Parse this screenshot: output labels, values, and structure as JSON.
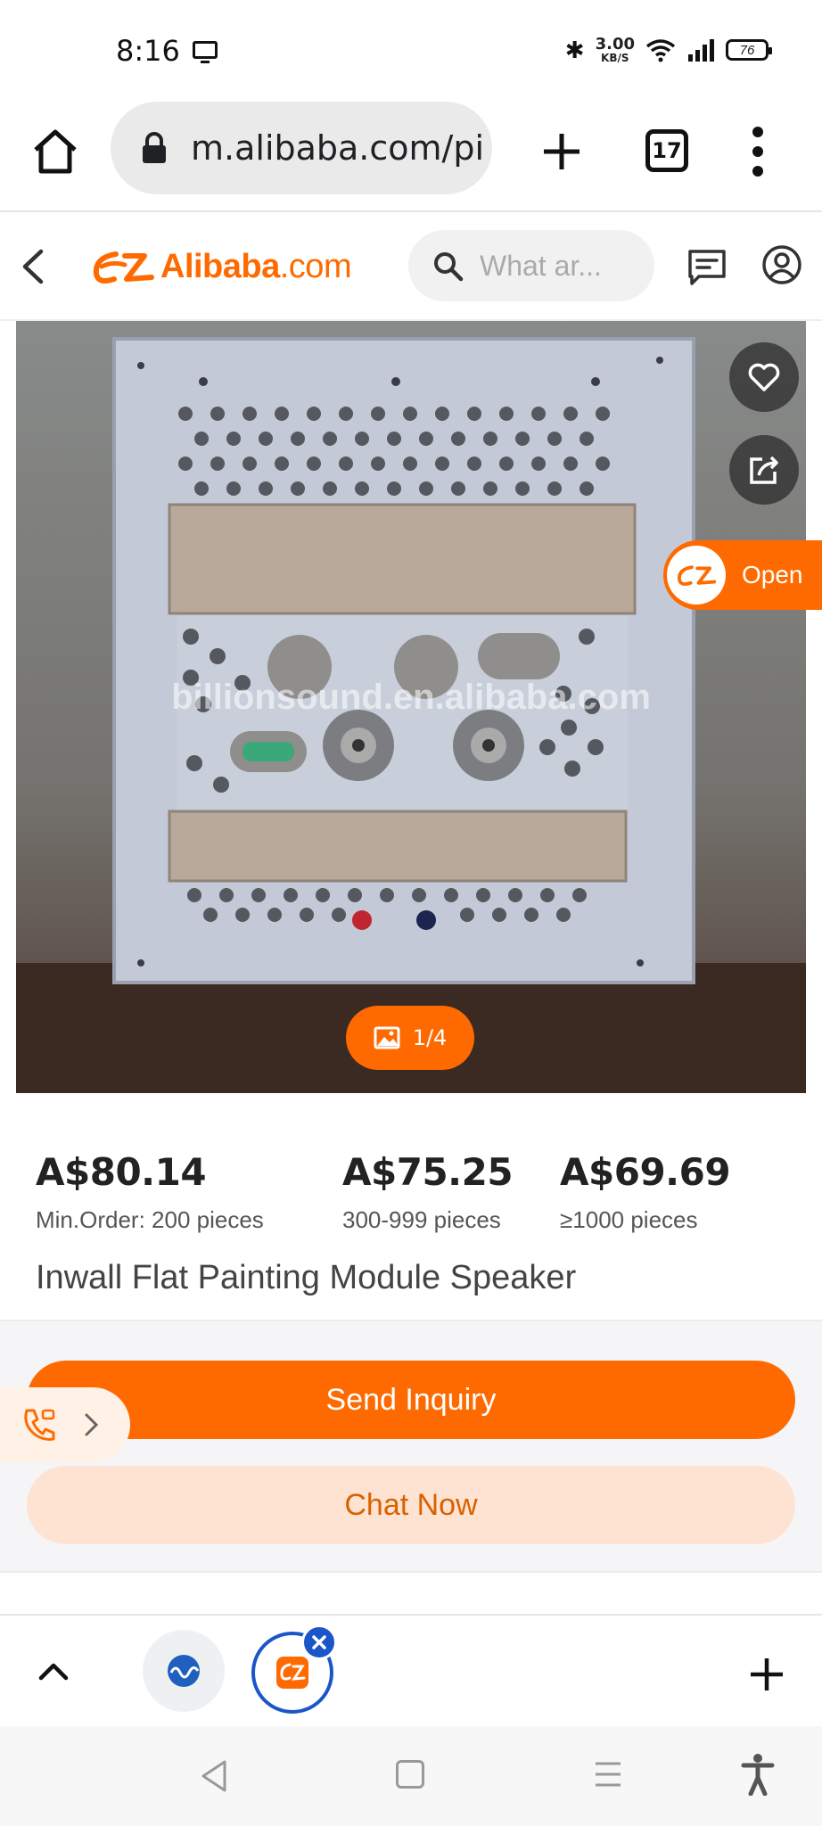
{
  "status_bar": {
    "time": "8:16",
    "net_speed_value": "3.00",
    "net_speed_unit": "KB/S",
    "battery": "76"
  },
  "browser": {
    "url": "m.alibaba.com/pi",
    "tab_count": "17"
  },
  "header": {
    "logo_text": "Alibaba",
    "logo_suffix": ".com",
    "search_placeholder": "What ar..."
  },
  "product_image": {
    "watermark": "billionsound.en.alibaba.com",
    "counter": "1/4",
    "open_label": "Open"
  },
  "prices": [
    {
      "price": "A$80.14",
      "qty": "Min.Order: 200 pieces"
    },
    {
      "price": "A$75.25",
      "qty": "300-999 pieces"
    },
    {
      "price": "A$69.69",
      "qty": "≥1000 pieces"
    }
  ],
  "product_title": "Inwall Flat Painting Module Speaker",
  "actions": {
    "send_inquiry": "Send Inquiry",
    "chat_now": "Chat Now"
  },
  "colors": {
    "brand_orange": "#ff6a00",
    "chat_bg": "#ffe3d2",
    "tab_active_blue": "#1a56c8"
  },
  "icons": {
    "home": "home-icon",
    "lock": "lock-icon",
    "new_tab": "plus-icon",
    "menu": "more-vertical-icon",
    "back": "chevron-left-icon",
    "search": "search-icon",
    "messages": "message-icon",
    "profile": "user-icon",
    "favorite": "heart-icon",
    "share": "share-icon",
    "gallery": "image-icon",
    "call": "phone-icon"
  }
}
